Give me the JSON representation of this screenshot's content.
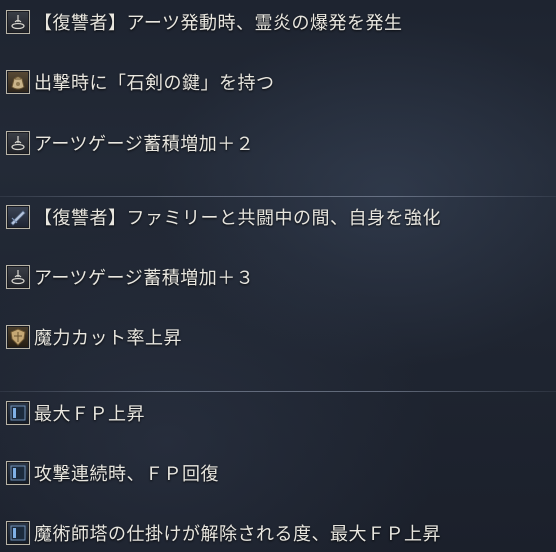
{
  "effects": {
    "group1": [
      {
        "icon": "flask-icon",
        "text": "【復讐者】アーツ発動時、霊炎の爆発を発生"
      },
      {
        "icon": "pouch-icon",
        "text": "出撃時に「石剣の鍵」を持つ"
      },
      {
        "icon": "flask-icon",
        "text": "アーツゲージ蓄積増加＋２"
      }
    ],
    "group2": [
      {
        "icon": "blade-icon",
        "text": "【復讐者】ファミリーと共闘中の間、自身を強化"
      },
      {
        "icon": "flask-icon",
        "text": "アーツゲージ蓄積増加＋３"
      },
      {
        "icon": "shield-icon",
        "text": "魔力カット率上昇"
      }
    ],
    "group3": [
      {
        "icon": "blue-frame-icon",
        "text": "最大ＦＰ上昇"
      },
      {
        "icon": "blue-frame-icon",
        "text": "攻撃連続時、ＦＰ回復"
      },
      {
        "icon": "blue-frame-icon",
        "text": "魔術師塔の仕掛けが解除される度、最大ＦＰ上昇"
      }
    ]
  }
}
